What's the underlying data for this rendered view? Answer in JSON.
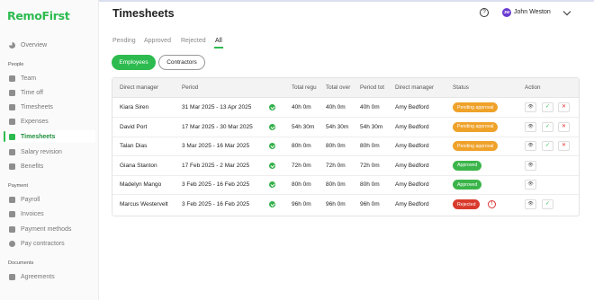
{
  "app": {
    "logo": "RemoFirst",
    "page_title": "Timesheets"
  },
  "colors": {
    "accent": "#2dbb4f",
    "pending": "#efa22a",
    "approved": "#3bb54a",
    "rejected": "#d93a2c",
    "avatar": "#6a3bd1"
  },
  "header": {
    "help_icon": "?",
    "user_initials": "JW",
    "user_name": "John Weston"
  },
  "sidebar": {
    "sections": [
      {
        "label": "",
        "items": [
          {
            "label": "Overview",
            "icon": "pie-chart-icon"
          }
        ]
      },
      {
        "label": "People",
        "items": [
          {
            "label": "Team",
            "icon": "team-icon"
          },
          {
            "label": "Time off",
            "icon": "calendar-icon"
          },
          {
            "label": "Timesheets",
            "icon": "document-icon"
          },
          {
            "label": "Expenses",
            "icon": "expenses-icon"
          },
          {
            "label": "Timesheets",
            "icon": "timesheets-icon",
            "active": true
          },
          {
            "label": "Salary revision",
            "icon": "salary-icon"
          },
          {
            "label": "Benefits",
            "icon": "benefits-icon"
          }
        ]
      },
      {
        "label": "Payment",
        "items": [
          {
            "label": "Payroll",
            "icon": "payroll-icon"
          },
          {
            "label": "Invoices",
            "icon": "invoice-icon"
          },
          {
            "label": "Payment methods",
            "icon": "card-icon"
          },
          {
            "label": "Pay contractors",
            "icon": "dollar-icon"
          }
        ]
      },
      {
        "label": "Documents",
        "items": [
          {
            "label": "Agreements",
            "icon": "agreement-icon"
          }
        ]
      }
    ]
  },
  "tabs": [
    "Pending",
    "Approved",
    "Rejected",
    "All"
  ],
  "active_tab": "All",
  "segments": [
    "Employees",
    "Contractors"
  ],
  "active_segment": "Employees",
  "table": {
    "headers": [
      "Direct manager",
      "Period",
      "Total regu",
      "Total over",
      "Period tot",
      "Direct manager",
      "Status",
      "Action"
    ],
    "rows": [
      {
        "manager": "Kiara Siren",
        "period": "31 Mar 2025 - 13 Apr 2025",
        "regular": "40h 0m",
        "overtime": "40h 0m",
        "total": "40h 0m",
        "direct": "Amy Bedford",
        "status": "Pending approval",
        "status_type": "pending",
        "actions": [
          "view",
          "approve",
          "reject"
        ]
      },
      {
        "manager": "David Port",
        "period": "17 Mar 2025 - 30 Mar 2025",
        "regular": "54h 30m",
        "overtime": "54h 30m",
        "total": "54h 30m",
        "direct": "Amy Bedford",
        "status": "Pending approval",
        "status_type": "pending",
        "actions": [
          "view",
          "approve",
          "reject"
        ]
      },
      {
        "manager": "Talan Dias",
        "period": "3 Mar 2025 - 16 Mar 2025",
        "regular": "80h 0m",
        "overtime": "80h 0m",
        "total": "80h 0m",
        "direct": "Amy Bedford",
        "status": "Pending approval",
        "status_type": "pending",
        "actions": [
          "view",
          "approve",
          "reject"
        ]
      },
      {
        "manager": "Giana Stanton",
        "period": "17 Feb 2025 - 2 Mar 2025",
        "regular": "72h 0m",
        "overtime": "72h 0m",
        "total": "72h 0m",
        "direct": "Amy Bedford",
        "status": "Approved",
        "status_type": "approved",
        "actions": [
          "view"
        ]
      },
      {
        "manager": "Madelyn Mango",
        "period": "3 Feb 2025 - 16 Feb 2025",
        "regular": "80h 0m",
        "overtime": "80h 0m",
        "total": "80h 0m",
        "direct": "Amy Bedford",
        "status": "Approved",
        "status_type": "approved",
        "actions": [
          "view"
        ]
      },
      {
        "manager": "Marcus Westervelt",
        "period": "3 Feb 2025 - 16 Feb 2025",
        "regular": "96h 0m",
        "overtime": "96h 0m",
        "total": "96h 0m",
        "direct": "Amy Bedford",
        "status": "Rejected",
        "status_type": "rejected",
        "actions": [
          "view",
          "approve"
        ]
      }
    ]
  }
}
